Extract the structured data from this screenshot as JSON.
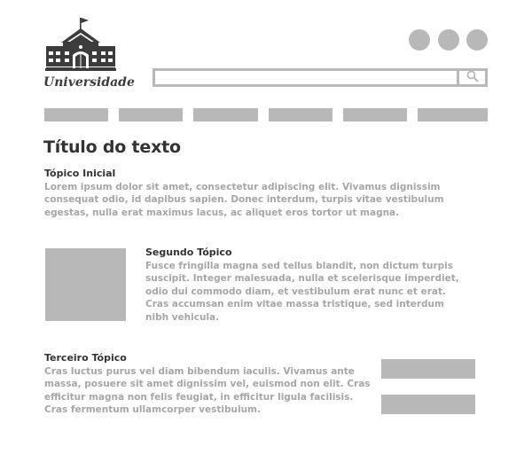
{
  "header": {
    "logo_text": "Universidade",
    "logo_icon": "university-building-icon",
    "circles": [
      "circle-icon",
      "circle-icon",
      "circle-icon"
    ],
    "search": {
      "placeholder": "",
      "value": "",
      "button_icon": "search-icon"
    }
  },
  "nav": {
    "items": [
      "",
      "",
      "",
      "",
      "",
      ""
    ]
  },
  "main": {
    "title": "Título do texto",
    "sections": [
      {
        "heading": "Tópico Inicial",
        "body": "Lorem ipsum dolor sit amet, consectetur adipiscing elit. Vivamus dignissim\nconsequat odio, id dapibus sapien. Donec interdum, turpis vitae vestibulum\negestas, nulla erat maximus lacus, ac aliquet eros tortor ut magna."
      },
      {
        "heading": "Segundo Tópico",
        "body": "Fusce fringilla magna sed tellus blandit, non dictum turpis\nsuscipit. Integer malesuada, nulla et scelerisque imperdiet,\nodio dui commodo diam, et vestibulum erat nunc et erat.\nCras accumsan enim vitae massa tristique, sed interdum\nnibh vehicula."
      },
      {
        "heading": "Terceiro Tópico",
        "body": "Cras luctus purus vel diam bibendum iaculis. Vivamus ante\nmassa, posuere sit amet dignissim vel, euismod non elit. Cras\nefficitur magna non felis feugiat, in efficitur ligula facilisis.\nCras fermentum ullamcorper vestibulum."
      }
    ]
  },
  "colors": {
    "placeholder_gray": "#b8b8b8",
    "heading_dark": "#333333",
    "body_gray": "#a6a6a6"
  }
}
